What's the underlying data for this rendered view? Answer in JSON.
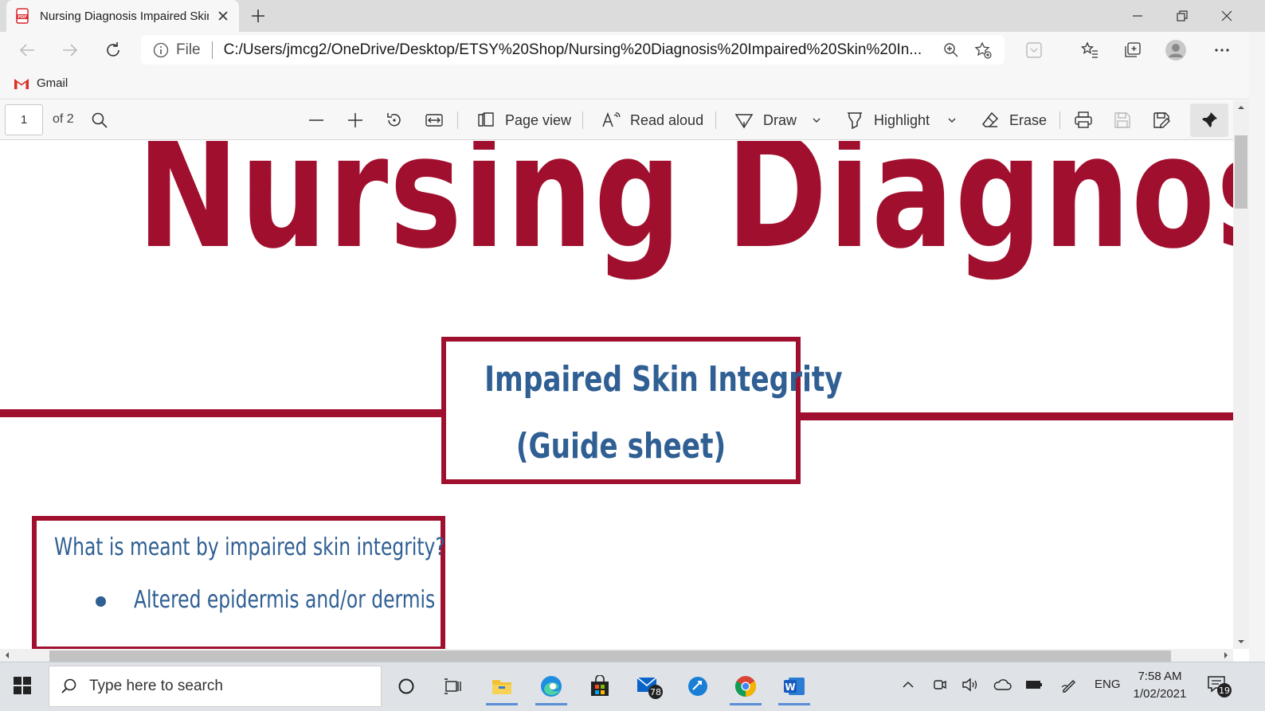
{
  "browser": {
    "tab": {
      "title": "Nursing Diagnosis Impaired Skin",
      "icon": "pdf-icon"
    },
    "address": {
      "scheme_label": "File",
      "url": "C:/Users/jmcg2/OneDrive/Desktop/ETSY%20Shop/Nursing%20Diagnosis%20Impaired%20Skin%20In..."
    },
    "bookmarks": [
      {
        "label": "Gmail",
        "icon": "gmail-icon"
      }
    ]
  },
  "pdf_toolbar": {
    "page_number": "1",
    "page_count": "of 2",
    "page_view": "Page view",
    "read_aloud": "Read aloud",
    "draw": "Draw",
    "highlight": "Highlight",
    "erase": "Erase"
  },
  "document": {
    "title": "Nursing Diagnosis",
    "subtitle_line1": "Impaired Skin Integrity",
    "subtitle_line2": "(Guide sheet)",
    "question": "What is meant by impaired skin integrity?",
    "bullets": [
      "Altered epidermis and/or dermis"
    ],
    "colors": {
      "accent": "#a0102e",
      "text_blue": "#2f5f93"
    }
  },
  "taskbar": {
    "search_placeholder": "Type here to search",
    "mail_badge": "78",
    "language": "ENG",
    "time": "7:58 AM",
    "date": "1/02/2021",
    "notifications": "19"
  }
}
